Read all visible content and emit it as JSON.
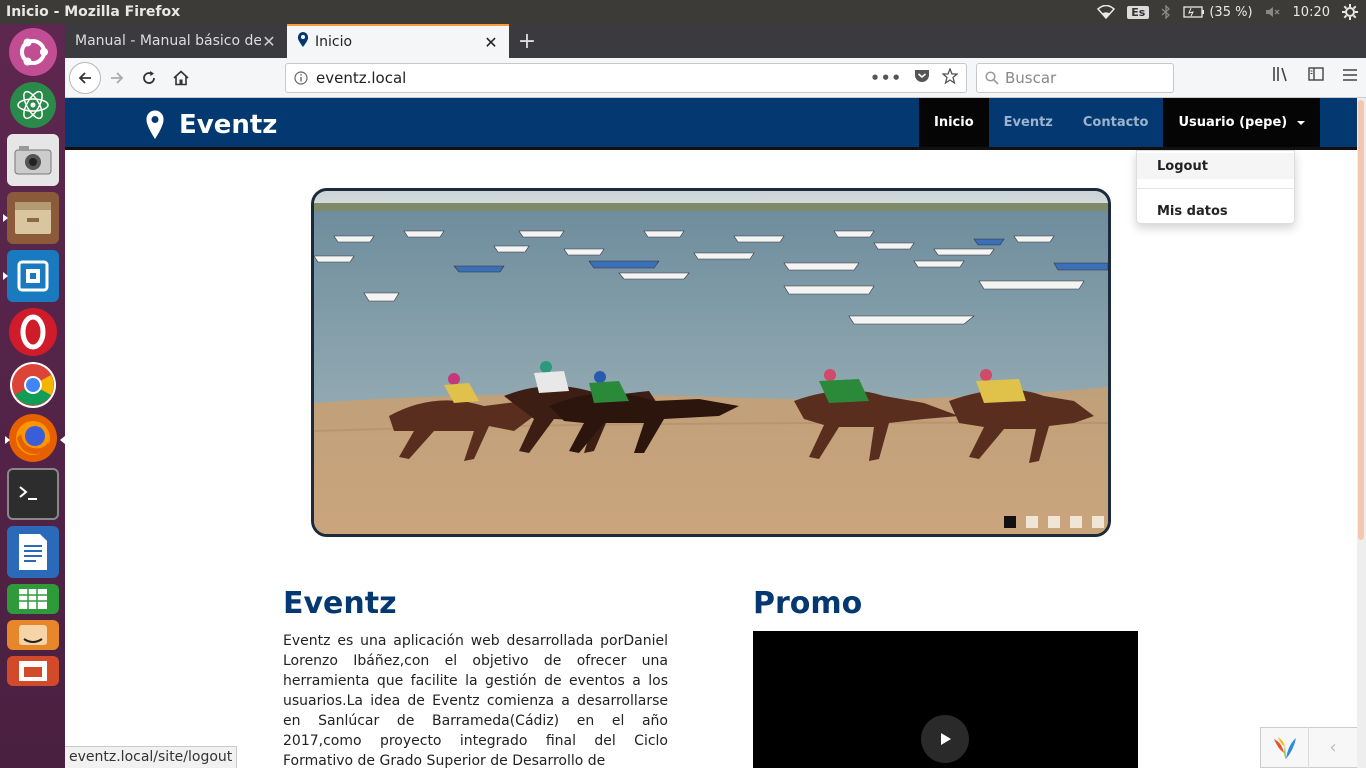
{
  "window": {
    "title": "Inicio - Mozilla Firefox",
    "keyboard_layout": "Es",
    "battery": "(35 %)",
    "clock": "10:20"
  },
  "launcher": {
    "apps": [
      "ubuntu-logo-icon",
      "atom-icon",
      "camera-icon",
      "files-icon",
      "vmware-icon",
      "opera-icon",
      "chrome-icon",
      "firefox-icon",
      "terminal-icon",
      "writer-icon",
      "calc-icon",
      "amazon-icon",
      "impress-icon"
    ]
  },
  "browser": {
    "tabs": [
      {
        "label": "Manual - Manual básico de u"
      },
      {
        "label": "Inicio"
      }
    ],
    "url": "eventz.local",
    "search_placeholder": "Buscar",
    "status_url": "eventz.local/site/logout"
  },
  "site": {
    "brand": "Eventz",
    "nav": [
      "Inicio",
      "Eventz",
      "Contacto"
    ],
    "user_menu": "Usuario (pepe)",
    "dropdown": [
      "Logout",
      "Mis datos"
    ],
    "carousel": {
      "slides": 5,
      "active_slide": 1
    },
    "about": {
      "title": "Eventz",
      "text": "Eventz es una aplicación web desarrollada porDaniel Lorenzo Ibáñez,con el objetivo de ofrecer una herramienta que facilite la gestión de eventos a los usuarios.La idea de Eventz comienza a desarrollarse en Sanlúcar de Barrameda(Cádiz) en el año 2017,como proyecto integrado final del Ciclo Formativo de Grado Superior de Desarrollo de"
    },
    "promo": {
      "title": "Promo"
    }
  },
  "colors": {
    "header": "#043870",
    "accent_tab": "#ff9a3c",
    "launcher": "#5e2750"
  }
}
